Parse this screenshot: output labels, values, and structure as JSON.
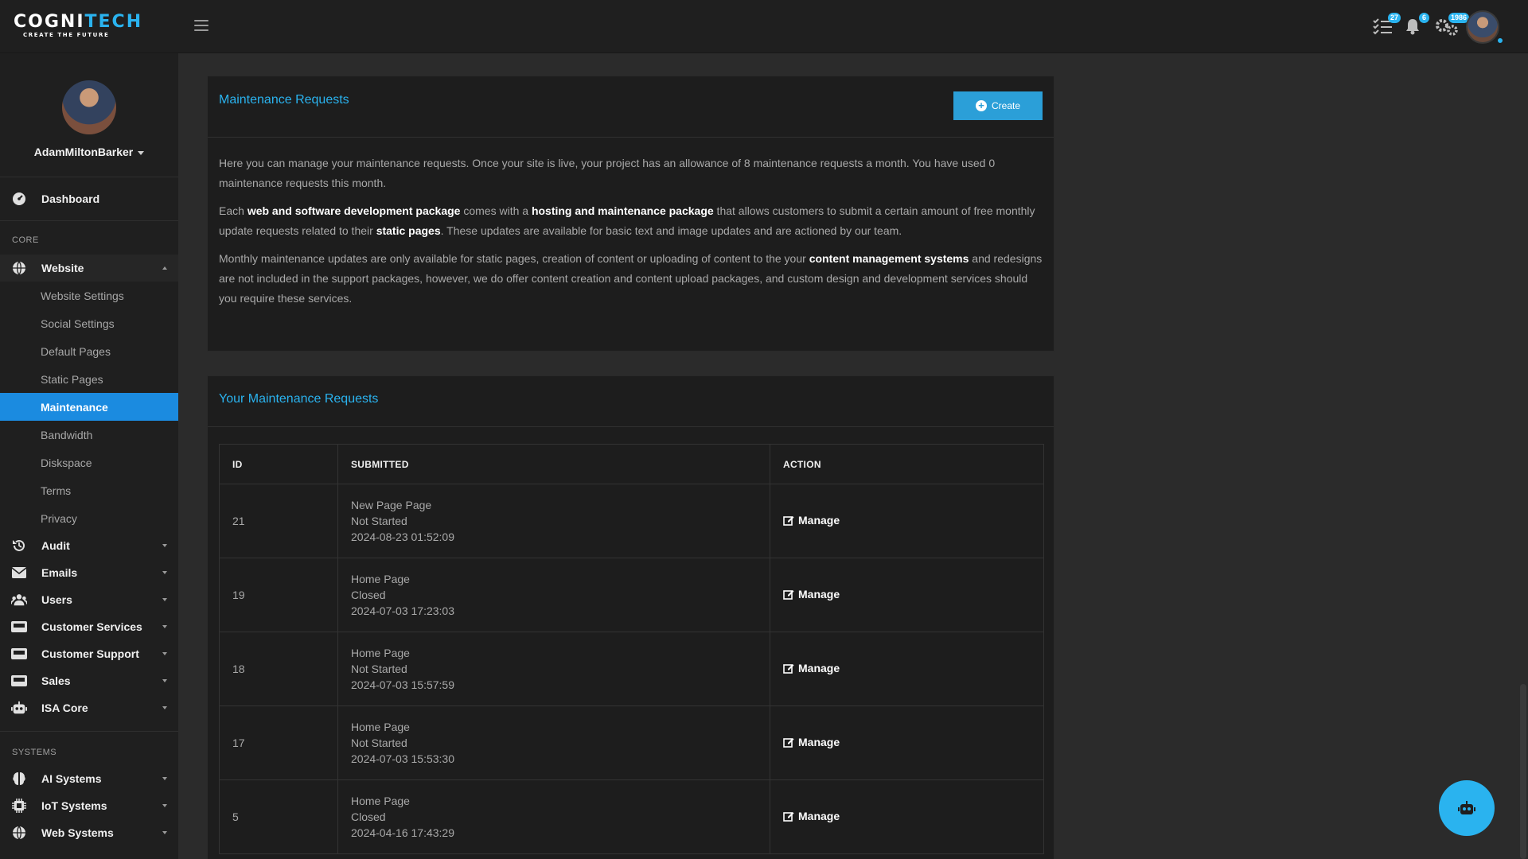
{
  "brand": {
    "name_a": "COGNI",
    "name_b": "TECH",
    "tagline": "CREATE THE FUTURE"
  },
  "topbar": {
    "badges": {
      "tasks": "27",
      "notifications": "6",
      "settings": "1986"
    }
  },
  "profile": {
    "name": "AdamMiltonBarker"
  },
  "sidebar": {
    "dashboard": "Dashboard",
    "core_label": "CORE",
    "website": "Website",
    "website_sub": [
      "Website Settings",
      "Social Settings",
      "Default Pages",
      "Static Pages",
      "Maintenance",
      "Bandwidth",
      "Diskspace",
      "Terms",
      "Privacy"
    ],
    "audit": "Audit",
    "emails": "Emails",
    "users": "Users",
    "customer_services": "Customer Services",
    "customer_support": "Customer Support",
    "sales": "Sales",
    "isa_core": "ISA Core",
    "systems_label": "SYSTEMS",
    "ai_systems": "AI Systems",
    "iot_systems": "IoT Systems",
    "web_systems": "Web Systems"
  },
  "card1": {
    "title": "Maintenance Requests",
    "create": "Create",
    "p1": "Here you can manage your maintenance requests. Once your site is live, your project has an allowance of 8 maintenance requests a month. You have used 0 maintenance requests this month.",
    "p2": {
      "t1": "Each ",
      "b1": "web and software development package",
      "t2": " comes with a ",
      "b2": "hosting and maintenance package",
      "t3": " that allows customers to submit a certain amount of free monthly update requests related to their ",
      "b3": "static pages",
      "t4": ". These updates are available for basic text and image updates and are actioned by our team."
    },
    "p3": {
      "t1": "Monthly maintenance updates are only available for static pages, creation of content or uploading of content to the your ",
      "b1": "content management systems",
      "t2": " and redesigns are not included in the support packages, however, we do offer content creation and content upload packages, and custom design and development services should you require these services."
    }
  },
  "card2": {
    "title": "Your Maintenance Requests",
    "columns": [
      "ID",
      "SUBMITTED",
      "ACTION"
    ],
    "action_label": "Manage",
    "rows": [
      {
        "id": "21",
        "page": "New Page Page",
        "status": "Not Started",
        "date": "2024-08-23 01:52:09"
      },
      {
        "id": "19",
        "page": "Home Page",
        "status": "Closed",
        "date": "2024-07-03 17:23:03"
      },
      {
        "id": "18",
        "page": "Home Page",
        "status": "Not Started",
        "date": "2024-07-03 15:57:59"
      },
      {
        "id": "17",
        "page": "Home Page",
        "status": "Not Started",
        "date": "2024-07-03 15:53:30"
      },
      {
        "id": "5",
        "page": "Home Page",
        "status": "Closed",
        "date": "2024-04-16 17:43:29"
      }
    ]
  },
  "colors": {
    "accent": "#2ab3ef",
    "active_nav": "#1b8be0",
    "background": "#2b2b2b",
    "panel": "#1d1d1d"
  }
}
